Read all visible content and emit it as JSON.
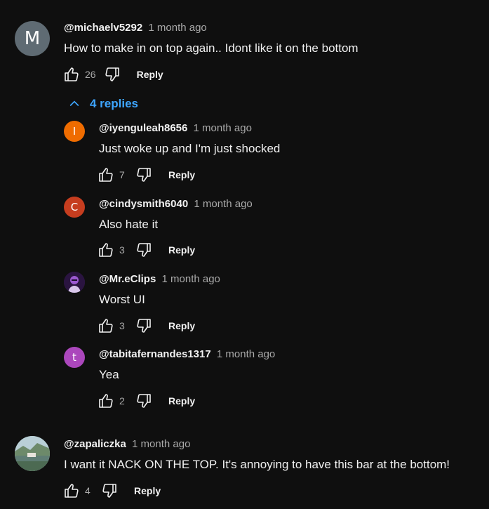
{
  "comments": [
    {
      "author": "@michaelv5292",
      "time": "1 month ago",
      "text": "How to make in on top again.. Idont like it on the bottom",
      "likes": "26",
      "reply_label": "Reply",
      "avatar_letter": "M",
      "avatar_color": "#5f6b73",
      "replies_toggle": "4 replies",
      "replies": [
        {
          "author": "@iyenguleah8656",
          "time": "1 month ago",
          "text": "Just woke up and I'm just shocked",
          "likes": "7",
          "reply_label": "Reply",
          "avatar_letter": "I",
          "avatar_color": "#ef6c00"
        },
        {
          "author": "@cindysmith6040",
          "time": "1 month ago",
          "text": "Also hate it",
          "likes": "3",
          "reply_label": "Reply",
          "avatar_letter": "C",
          "avatar_color": "#c63d1f"
        },
        {
          "author": "@Mr.eClips",
          "time": "1 month ago",
          "text": "Worst UI",
          "likes": "3",
          "reply_label": "Reply",
          "avatar_letter": "",
          "avatar_color": "#3a1f5c"
        },
        {
          "author": "@tabitafernandes1317",
          "time": "1 month ago",
          "text": "Yea",
          "likes": "2",
          "reply_label": "Reply",
          "avatar_letter": "t",
          "avatar_color": "#ab47bc"
        }
      ]
    },
    {
      "author": "@zapaliczka",
      "time": "1 month ago",
      "text": "I want it NACK ON THE TOP.  It's annoying to have this bar at the bottom!",
      "likes": "4",
      "reply_label": "Reply",
      "avatar_letter": "",
      "avatar_color": "#7a9b8a"
    }
  ]
}
